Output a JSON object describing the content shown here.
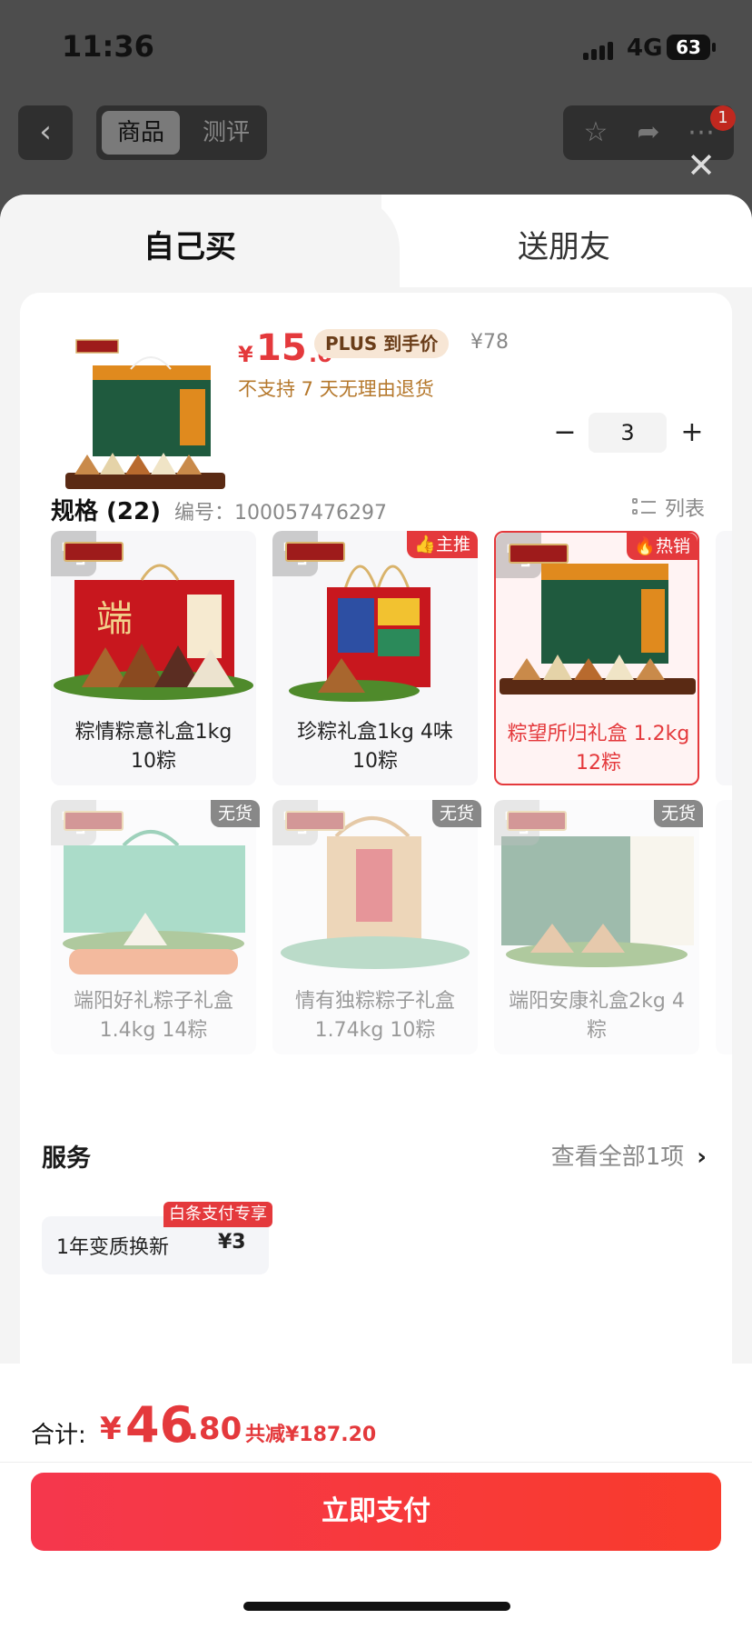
{
  "status": {
    "time": "11:36",
    "network": "4G",
    "battery": "63"
  },
  "header": {
    "tabs": [
      "商品",
      "测评"
    ],
    "notification_count": "1"
  },
  "sheet_tabs": {
    "self": "自己买",
    "friend": "送朋友"
  },
  "product": {
    "price_currency": "¥",
    "price_int": "15",
    "price_dec": ".6",
    "plus_label": "PLUS 到手价",
    "original_price": "¥78",
    "return_policy": "不支持 7 天无理由退货",
    "quantity": "3"
  },
  "specs": {
    "title": "规格 (22)",
    "id_label": "编号：",
    "id_value": "100057476297",
    "list_label": "列表",
    "items": [
      {
        "name": "粽情粽意礼盒1kg 10粽",
        "tag": "",
        "state": "normal"
      },
      {
        "name": "珍粽礼盒1kg 4味 10粽",
        "tag": "主推",
        "state": "normal"
      },
      {
        "name": "粽望所归礼盒 1.2kg 12粽",
        "tag": "热销",
        "state": "selected"
      },
      {
        "name": "端阳好礼粽子礼盒1.4kg 14粽",
        "tag": "无货",
        "state": "oos"
      },
      {
        "name": "情有独粽粽子礼盒1.74kg 10粽",
        "tag": "无货",
        "state": "oos"
      },
      {
        "name": "端阳安康礼盒2kg 4粽",
        "tag": "无货",
        "state": "oos"
      }
    ]
  },
  "service": {
    "title": "服务",
    "more": "查看全部1项",
    "item_name": "1年变质换新",
    "item_price": "¥3",
    "item_tag": "白条支付专享"
  },
  "footer": {
    "total_label": "合计:",
    "total_currency": "¥",
    "total_int": "46",
    "total_dec": ".80",
    "savings": "共减¥187.20",
    "pay_button": "立即支付"
  },
  "colors": {
    "accent": "#e4393c",
    "plus_bg": "#f7e6d5",
    "return_text": "#b5782c"
  }
}
